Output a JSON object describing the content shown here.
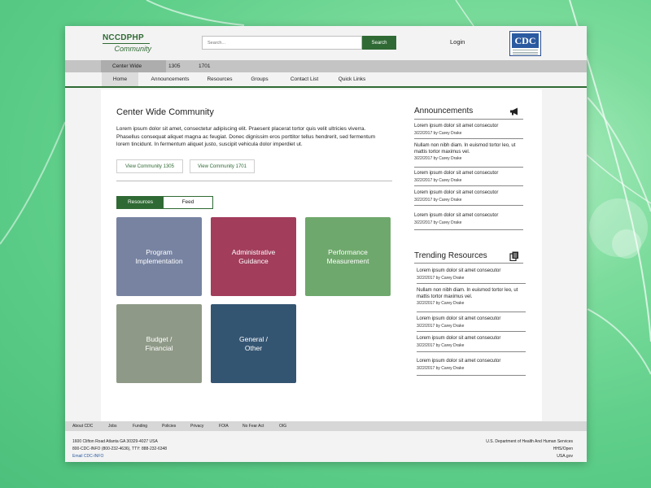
{
  "brand": {
    "name": "NCCDPHP",
    "subtitle": "Community"
  },
  "search": {
    "placeholder": "Search...",
    "button_label": "Search"
  },
  "header": {
    "login_label": "Login",
    "logo_text": "CDC"
  },
  "community_bar": {
    "items": [
      "Center Wide",
      "1305",
      "1701"
    ],
    "active": "Center Wide"
  },
  "nav": {
    "items": [
      "Home",
      "Announcements",
      "Resources",
      "Groups",
      "Contact List",
      "Quick Links"
    ],
    "active": "Home"
  },
  "main": {
    "title": "Center Wide Community",
    "intro": "Lorem ipsum dolor sit amet, consectetur adipiscing elit. Praesent placerat tortor quis velit ultricies viverra. Phasellus consequat aliquet magna ac feugiat. Donec dignissim eros porttitor tellus hendrerit, sed fermentum lorem tincidunt. In fermentum aliquet justo, suscipit vehicula dolor imperdiet ut.",
    "buttons": [
      "View Community 1305",
      "View Community 1701"
    ],
    "toggle": {
      "options": [
        "Resources",
        "Feed"
      ],
      "selected": "Resources"
    },
    "tiles": [
      {
        "line1": "Program",
        "line2": "Implementation",
        "color": "#7783a1"
      },
      {
        "line1": "Administrative",
        "line2": "Guidance",
        "color": "#a23d5c"
      },
      {
        "line1": "Performance",
        "line2": "Measurement",
        "color": "#6fa86c"
      },
      {
        "line1": "Budget /",
        "line2": "Financial",
        "color": "#8f9987"
      },
      {
        "line1": "General /",
        "line2": "Other",
        "color": "#345572"
      }
    ]
  },
  "announcements": {
    "title": "Announcements",
    "icon": "megaphone-icon",
    "items": [
      {
        "text": "Lorem ipsum dolor sit amet consecutor",
        "meta": "3/22/2017 by Carey Drake"
      },
      {
        "text": "Nullam non nibh diam. In euismod tortor leo, ut mattis tortor maximus vel.",
        "meta": "3/22/2017 by Carey Drake"
      },
      {
        "text": "Lorem ipsum dolor sit amet consecutor",
        "meta": "3/22/2017 by Carey Drake"
      },
      {
        "text": "Lorem ipsum dolor sit amet consecutor",
        "meta": "3/22/2017 by Carey Drake"
      },
      {
        "text": "Lorem ipsum dolor sit amet consecutor",
        "meta": "3/22/2017 by Carey Drake"
      }
    ]
  },
  "trending": {
    "title": "Trending Resources",
    "icon": "documents-icon",
    "items": [
      {
        "text": "Lorem ipsum dolor sit amet consecutor",
        "meta": "3/22/2017 by Carey Drake"
      },
      {
        "text": "Nullam non nibh diam. In euismod tortor leo, ut mattis tortor maximus vel.",
        "meta": "3/22/2017 by Carey Drake"
      },
      {
        "text": "Lorem ipsum dolor sit amet consecutor",
        "meta": "3/22/2017 by Carey Drake"
      },
      {
        "text": "Lorem ipsum dolor sit amet consecutor",
        "meta": "3/22/2017 by Carey Drake"
      },
      {
        "text": "Lorem ipsum dolor sit amet consecutor",
        "meta": "3/22/2017 by Carey Drake"
      }
    ]
  },
  "footer": {
    "links": [
      "About CDC",
      "Jobs",
      "Funding",
      "Policies",
      "Privacy",
      "FOIA",
      "No Fear Act",
      "OIG"
    ],
    "address": "1600 Clifton Road Atlanta GA 30329-4027 USA",
    "phone": "800-CDC-INFO (800-232-4636), TTY: 888-232-6348",
    "email": "Email CDC-INFO",
    "right": [
      "U.S. Department of Health And Human Services",
      "HHS/Open",
      "USA.gov"
    ]
  },
  "colors": {
    "brand_green": "#2f6a34",
    "cdc_blue": "#2a5aa0"
  }
}
